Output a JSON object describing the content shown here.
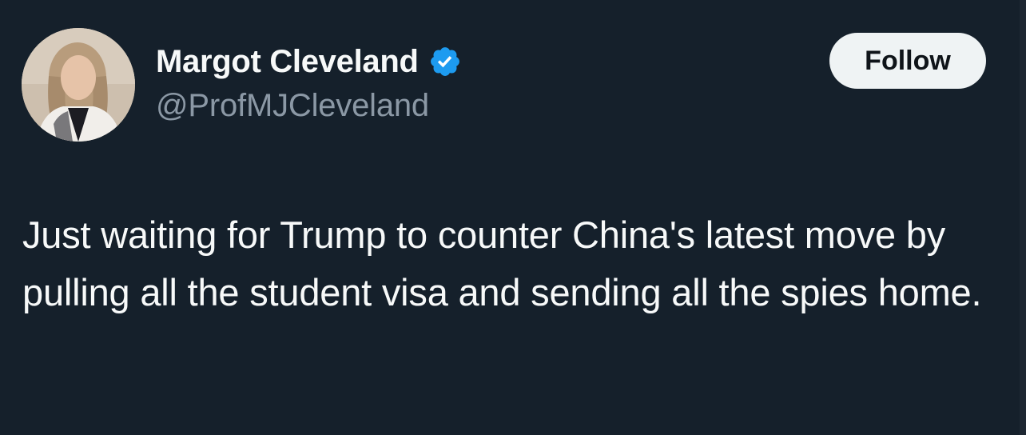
{
  "author": {
    "display_name": "Margot Cleveland",
    "handle": "@ProfMJCleveland",
    "verified_icon": "verified-badge-icon",
    "verified_color": "#1d9bf0",
    "avatar": "profile-photo"
  },
  "actions": {
    "follow_label": "Follow"
  },
  "tweet": {
    "text": "Just waiting for Trump to counter China's latest move by pulling all the student visa and sending all the spies home."
  },
  "colors": {
    "background": "#15202b",
    "primary_text": "#f7f9f9",
    "secondary_text": "#8b98a5",
    "follow_bg": "#eff3f4"
  }
}
